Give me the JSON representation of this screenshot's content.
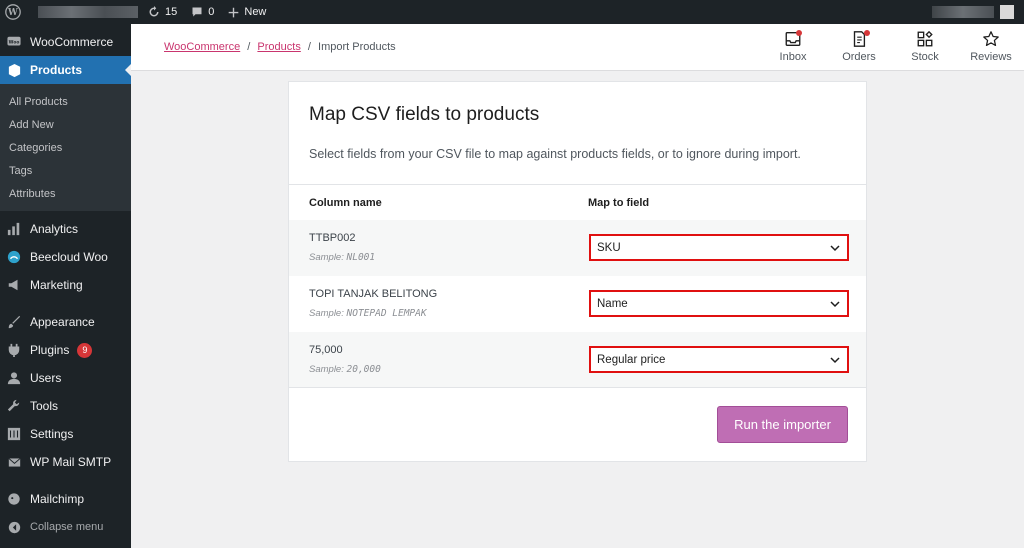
{
  "admin_bar": {
    "updates_count": "15",
    "comments_count": "0",
    "new_label": "New"
  },
  "sidebar": {
    "woocommerce_label": "WooCommerce",
    "products_label": "Products",
    "submenu": [
      "All Products",
      "Add New",
      "Categories",
      "Tags",
      "Attributes"
    ],
    "items": [
      {
        "label": "Analytics"
      },
      {
        "label": "Beecloud Woo"
      },
      {
        "label": "Marketing"
      },
      {
        "label": "Appearance"
      },
      {
        "label": "Plugins",
        "badge": "9"
      },
      {
        "label": "Users"
      },
      {
        "label": "Tools"
      },
      {
        "label": "Settings"
      },
      {
        "label": "WP Mail SMTP"
      },
      {
        "label": "Mailchimp"
      }
    ],
    "collapse_label": "Collapse menu"
  },
  "header": {
    "breadcrumb": {
      "root": "WooCommerce",
      "sep1": "/",
      "section": "Products",
      "sep2": "/",
      "current": "Import Products"
    },
    "icons": [
      {
        "label": "Inbox",
        "icon": "inbox-icon"
      },
      {
        "label": "Orders",
        "icon": "orders-icon"
      },
      {
        "label": "Stock",
        "icon": "stock-icon"
      },
      {
        "label": "Reviews",
        "icon": "star-icon"
      }
    ]
  },
  "card": {
    "title": "Map CSV fields to products",
    "description": "Select fields from your CSV file to map against products fields, or to ignore during import.",
    "column_header": "Column name",
    "map_header": "Map to field",
    "rows": [
      {
        "column": "TTBP002",
        "sample_label": "Sample:",
        "sample": "NL001",
        "field": "SKU"
      },
      {
        "column": "TOPI TANJAK BELITONG",
        "sample_label": "Sample:",
        "sample": "NOTEPAD LEMPAK",
        "field": "Name"
      },
      {
        "column": "75,000",
        "sample_label": "Sample:",
        "sample": "20,000",
        "field": "Regular price"
      }
    ],
    "run_button": "Run the importer"
  },
  "colors": {
    "admin_dark": "#1d2327",
    "active_blue": "#2271b1",
    "woo_purple": "#bf6eb4",
    "highlight_red": "#e01010",
    "link_pink": "#c9356e"
  }
}
